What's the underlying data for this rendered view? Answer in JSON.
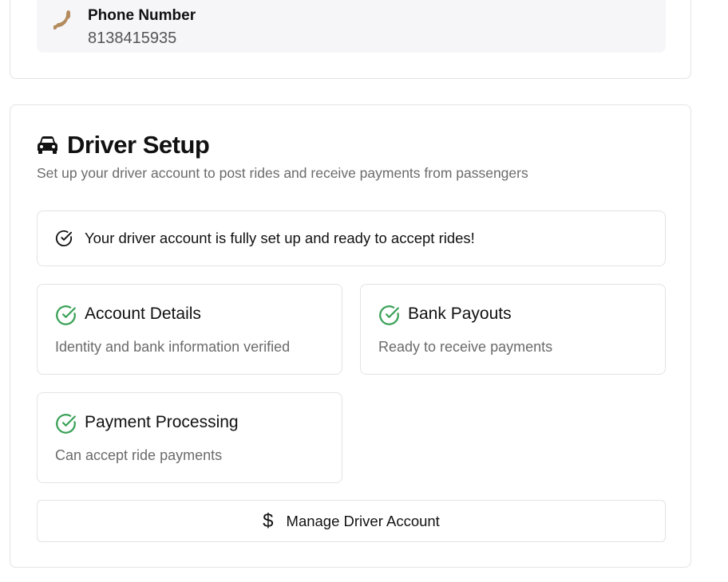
{
  "contact": {
    "phone_label": "Phone Number",
    "phone_value": "8138415935",
    "phone_icon": "phone-icon"
  },
  "driver_setup": {
    "title": "Driver Setup",
    "title_icon": "car-icon",
    "subtitle": "Set up your driver account to post rides and receive payments from passengers",
    "alert": {
      "icon": "check-circle-icon",
      "text": "Your driver account is fully set up and ready to accept rides!"
    },
    "status_cards": [
      {
        "title": "Account Details",
        "description": "Identity and bank information verified",
        "icon": "check-circle-icon"
      },
      {
        "title": "Bank Payouts",
        "description": "Ready to receive payments",
        "icon": "check-circle-icon"
      },
      {
        "title": "Payment Processing",
        "description": "Can accept ride payments",
        "icon": "check-circle-icon"
      }
    ],
    "manage_button": {
      "icon": "dollar-icon",
      "icon_glyph": "$",
      "label": "Manage Driver Account"
    }
  },
  "colors": {
    "success": "#3aa157",
    "phone_icon": "#b38b5d",
    "border": "#e3e3e6",
    "muted_text": "#6b6b6b"
  }
}
